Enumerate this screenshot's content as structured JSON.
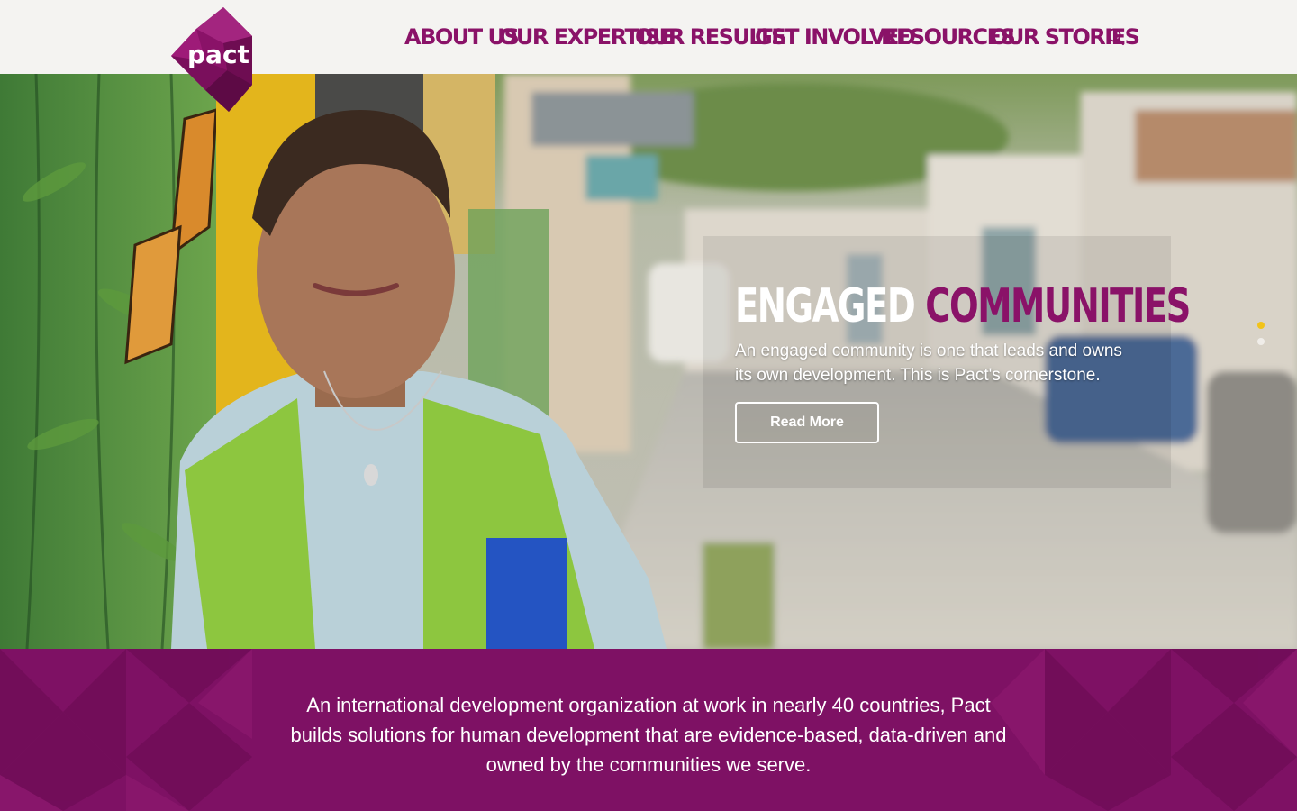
{
  "brand": {
    "logo_text": "pact",
    "primary_color": "#8a1268",
    "accent_color": "#f2c319"
  },
  "nav": {
    "items": [
      {
        "label": "ABOUT US"
      },
      {
        "label": "OUR EXPERTISE"
      },
      {
        "label": "OUR RESULTS"
      },
      {
        "label": "GET INVOLVED"
      },
      {
        "label": "RESOURCES"
      },
      {
        "label": "OUR STORIES"
      }
    ],
    "search_icon": "search-icon"
  },
  "hero": {
    "title_white": "ENGAGED",
    "title_purple": "COMMUNITIES",
    "text": "An engaged community is one that leads and owns its own development. This is Pact's cornerstone.",
    "button_label": "Read More",
    "slide_count": 2,
    "active_slide": 1
  },
  "mission": {
    "text": "An international development organization at work in nearly 40 countries, Pact builds solutions for human development that are evidence-based, data-driven and owned by the communities we serve."
  }
}
